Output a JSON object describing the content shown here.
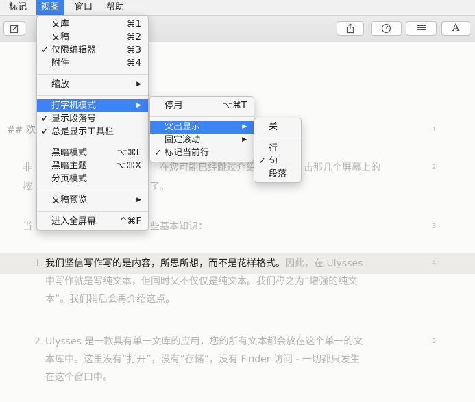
{
  "menubar": {
    "items": [
      "标记",
      "视图",
      "窗口",
      "帮助"
    ]
  },
  "toolbar": {
    "compose_icon": "compose-icon",
    "right_icons": [
      "share-icon",
      "speedometer-icon",
      "list-icon",
      "font-icon"
    ],
    "font_glyph": "A"
  },
  "editor": {
    "heading_fragment": "## 欢",
    "para1_line1_left": "非",
    "para1_line1_mid": "在您可能已经跳过介绍",
    "para1_line1_right": "击那几个屏幕上的",
    "para1_line2_left": "按",
    "para1_line2_right": "了。",
    "para2_left": "当",
    "para2_right": "些基本知识：",
    "item1": {
      "num": "1.",
      "bold": "我们坚信写作写的是内容，所思所想，而不是花样格式。",
      "rest1": "因此，在 Ulysses",
      "line2": "中写作就是写纯文本，但同时又不仅仅是纯文本。我们称之为“增强的纯文",
      "line3": "本”。我们稍后会再介绍这点。"
    },
    "item2": {
      "num": "2.",
      "line1": "Ulysses 是一款具有单一文库的应用，您的所有文本都会放在这个单一的文",
      "line2": "本库中。这里没有“打开”，没有“存储”，没有 Finder 访问 - 一切都只发生",
      "line3": "在这个窗口中。"
    },
    "line_numbers": [
      "1",
      "2",
      "3",
      "4",
      "5"
    ]
  },
  "view_menu": {
    "items": [
      {
        "label": "文库",
        "shortcut": "⌘1"
      },
      {
        "label": "文稿",
        "shortcut": "⌘2"
      },
      {
        "label": "仅限编辑器",
        "shortcut": "⌘3",
        "checked": "✓"
      },
      {
        "label": "附件",
        "shortcut": "⌘4"
      },
      {
        "label": "缩放",
        "submenu": "▶"
      },
      {
        "label": "打字机模式",
        "submenu": "▶"
      },
      {
        "label": "显示段落号",
        "checked": "✓"
      },
      {
        "label": "总是显示工具栏",
        "checked": "✓"
      },
      {
        "label": "黑暗模式",
        "shortcut": "⌥⌘L"
      },
      {
        "label": "黑暗主题",
        "shortcut": "⌥⌘X"
      },
      {
        "label": "分页模式"
      },
      {
        "label": "文稿预览",
        "submenu": "▶"
      },
      {
        "label": "进入全屏幕",
        "shortcut": "^⌘F"
      }
    ]
  },
  "typewriter_menu": {
    "items": [
      {
        "label": "停用",
        "shortcut": "⌥⌘T"
      },
      {
        "label": "突出显示",
        "submenu": "▶"
      },
      {
        "label": "固定滚动",
        "submenu": "▶"
      },
      {
        "label": "标记当前行",
        "checked": "✓"
      }
    ]
  },
  "highlight_menu": {
    "items": [
      {
        "label": "关"
      },
      {
        "label": "行"
      },
      {
        "label": "句",
        "checked": "✓"
      },
      {
        "label": "段落"
      }
    ]
  }
}
